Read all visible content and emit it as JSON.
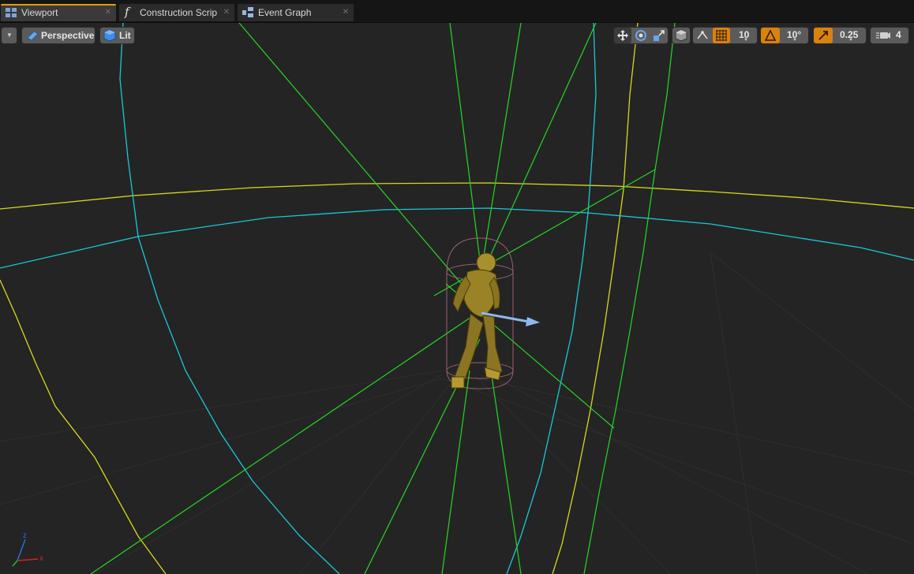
{
  "tabs": [
    {
      "label": "Viewport",
      "icon": "viewport-icon",
      "active": true
    },
    {
      "label": "Construction Scrip",
      "icon": "function-icon",
      "active": false
    },
    {
      "label": "Event Graph",
      "icon": "event-graph-icon",
      "active": false
    }
  ],
  "toolbar": {
    "view_mode": "Perspective",
    "lighting": "Lit",
    "grid_snap": "10",
    "rotation_snap": "10°",
    "scale_snap": "0.25",
    "camera_speed": "4"
  },
  "axis": {
    "z": "z",
    "x": "x"
  },
  "colors": {
    "accent": "#e59a10",
    "green": "#22d622",
    "cyan": "#17c6d6",
    "yellow": "#d6d61a"
  }
}
